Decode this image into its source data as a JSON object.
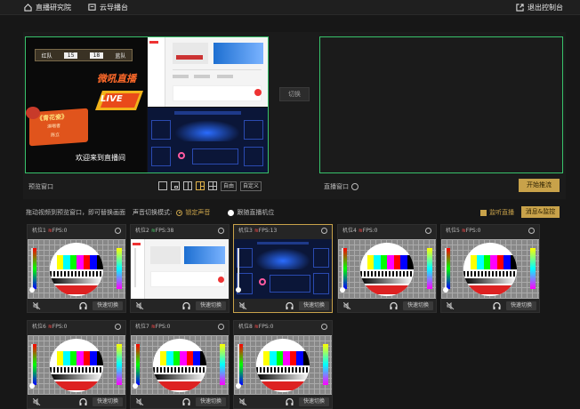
{
  "topbar": {
    "left_items": [
      {
        "label": "直播研究院",
        "icon": "home-icon"
      },
      {
        "label": "云导播台",
        "icon": "monitor-icon"
      }
    ],
    "exit_label": "退出控制台",
    "exit_icon": "exit-icon"
  },
  "preview": {
    "label": "预览窗口",
    "score": {
      "team_left": "红队",
      "score_left": "15",
      "score_right": "18",
      "team_right": "蓝队"
    },
    "overlay_texts": {
      "live_title": "微吼直播",
      "live_badge": "LIVE",
      "welcome": "欢迎来到直播间",
      "scroll_title": "《青花瓷》",
      "scroll_line1": "演唱者",
      "scroll_line2": "陈立"
    },
    "layout_buttons": [
      "single",
      "pip",
      "split-2",
      "split-3",
      "grid-4"
    ],
    "layout_text_buttons": [
      "自由",
      "自定义"
    ]
  },
  "switch_button": "切换",
  "live_window": {
    "label": "直播窗口",
    "start_button": "开始推流"
  },
  "controls": {
    "hint": "拖动视频到预览窗口，即可替换画面",
    "audio_mode_label": "声音切换模式:",
    "option_lock": "锁定声音",
    "option_follow": "跟随直播机位",
    "monitor_checkbox": "监听直播",
    "monitor_button": "消息&监控"
  },
  "cameras": [
    {
      "name": "机位1",
      "fps": "FPS:0",
      "signal": "bad",
      "feed": "testcard",
      "quick": "快速切换"
    },
    {
      "name": "机位2",
      "fps": "FPS:38",
      "signal": "good",
      "feed": "web",
      "quick": "快速切换"
    },
    {
      "name": "机位3",
      "fps": "FPS:13",
      "signal": "bad",
      "feed": "dashboard",
      "quick": "快速切换",
      "active": true
    },
    {
      "name": "机位4",
      "fps": "FPS:0",
      "signal": "bad",
      "feed": "testcard",
      "quick": "快速切换"
    },
    {
      "name": "机位5",
      "fps": "FPS:0",
      "signal": "bad",
      "feed": "testcard",
      "quick": "快速切换"
    },
    {
      "name": "机位6",
      "fps": "FPS:0",
      "signal": "bad",
      "feed": "testcard",
      "quick": "快速切换"
    },
    {
      "name": "机位7",
      "fps": "FPS:0",
      "signal": "bad",
      "feed": "testcard",
      "quick": "快速切换"
    },
    {
      "name": "机位8",
      "fps": "FPS:0",
      "signal": "bad",
      "feed": "testcard",
      "quick": "快速切换"
    }
  ],
  "colors": {
    "accent_gold": "#c8a24a",
    "window_border": "#38c26b",
    "bad_signal": "#ff4a4a",
    "good_signal": "#4ccc6a"
  }
}
